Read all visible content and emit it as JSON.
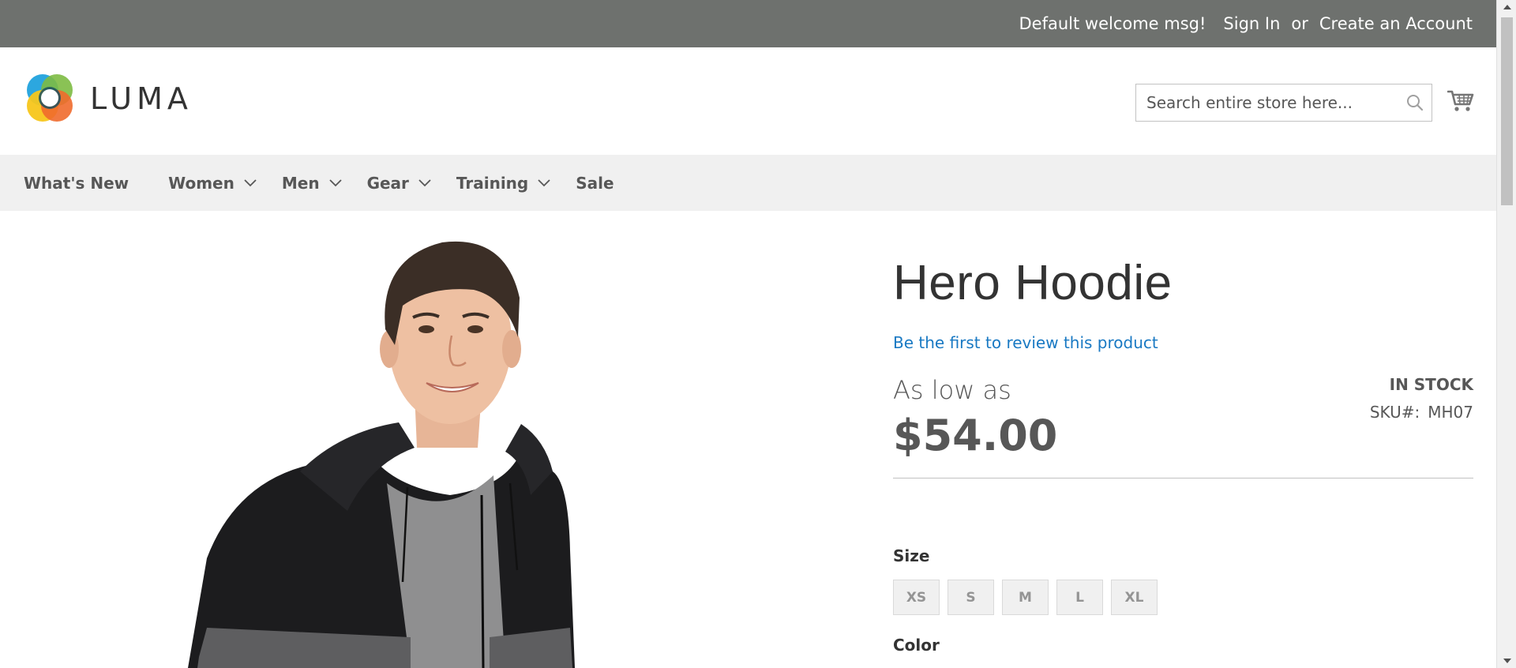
{
  "topbar": {
    "welcome": "Default welcome msg!",
    "sign_in": "Sign In",
    "or": "or",
    "create_account": "Create an Account"
  },
  "header": {
    "logo_text": "LUMA",
    "search_placeholder": "Search entire store here...",
    "icons": [
      "search-icon",
      "cart-icon"
    ]
  },
  "nav": {
    "items": [
      {
        "label": "What's New",
        "has_dropdown": false
      },
      {
        "label": "Women",
        "has_dropdown": true
      },
      {
        "label": "Men",
        "has_dropdown": true
      },
      {
        "label": "Gear",
        "has_dropdown": true
      },
      {
        "label": "Training",
        "has_dropdown": true
      },
      {
        "label": "Sale",
        "has_dropdown": false
      }
    ]
  },
  "product": {
    "name": "Hero Hoodie",
    "review_link": "Be the first to review this product",
    "price_prefix": "As low as",
    "price": "$54.00",
    "stock": "IN STOCK",
    "sku_label": "SKU#:",
    "sku_value": "MH07",
    "size_label": "Size",
    "sizes": [
      "XS",
      "S",
      "M",
      "L",
      "XL"
    ],
    "color_label": "Color"
  },
  "colors": {
    "topbar_bg": "#6e716e",
    "nav_bg": "#f0f0f0",
    "link": "#1979c3",
    "text_dark": "#333333",
    "text_muted": "#575757"
  }
}
